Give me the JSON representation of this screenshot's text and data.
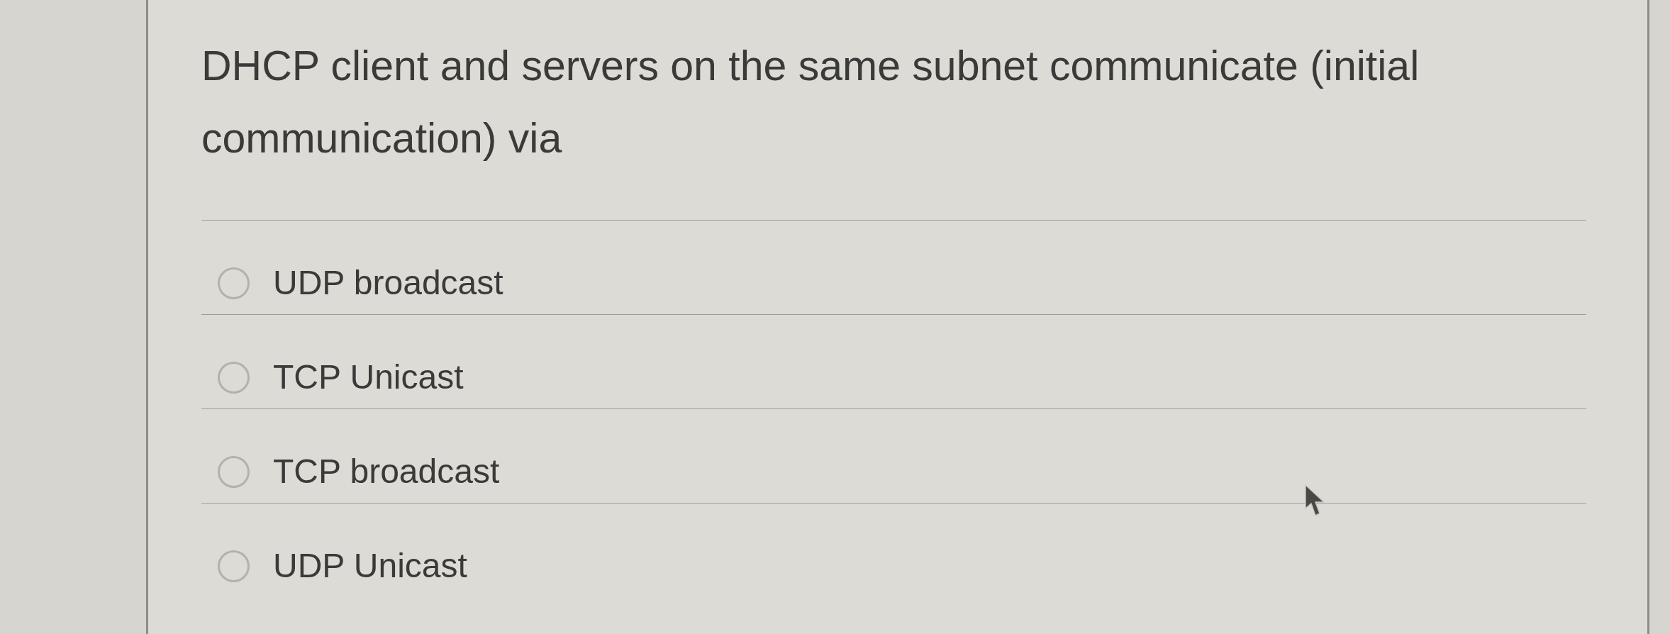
{
  "question": {
    "text": "DHCP client and servers on the same subnet communicate (initial communication) via"
  },
  "options": [
    {
      "label": "UDP broadcast",
      "selected": false
    },
    {
      "label": "TCP Unicast",
      "selected": false
    },
    {
      "label": "TCP broadcast",
      "selected": false
    },
    {
      "label": "UDP Unicast",
      "selected": false
    }
  ]
}
